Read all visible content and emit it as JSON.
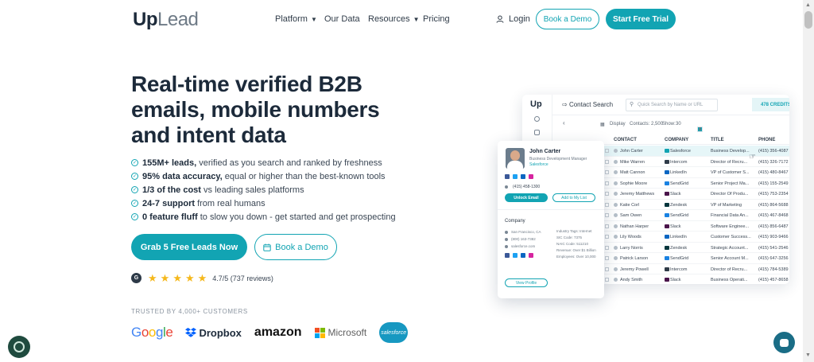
{
  "header": {
    "logo_up": "Up",
    "logo_lead": "Lead",
    "nav": [
      {
        "label": "Platform",
        "chevron": true
      },
      {
        "label": "Our Data",
        "chevron": false
      },
      {
        "label": "Resources",
        "chevron": true
      },
      {
        "label": "Pricing",
        "chevron": false
      }
    ],
    "login_label": "Login",
    "book_demo_label": "Book a Demo",
    "free_trial_label": "Start Free Trial"
  },
  "hero": {
    "title": "Real-time verified B2B emails, mobile numbers and intent data",
    "features": [
      {
        "bold": "155M+ leads,",
        "rest": " verified as you search and ranked by freshness"
      },
      {
        "bold": "95% data accuracy,",
        "rest": " equal or higher than the best-known tools"
      },
      {
        "bold": "1/3 of the cost",
        "rest": " vs leading sales platforms"
      },
      {
        "bold": "24-7 support",
        "rest": " from real humans"
      },
      {
        "bold": "0 feature fluff",
        "rest": " to slow you down - get started and get prospecting"
      }
    ],
    "cta_primary": "Grab 5 Free Leads Now",
    "cta_secondary": "Book a Demo",
    "rating_text": "4.7/5 (737 reviews)",
    "rating_stars": 5,
    "g2_badge": "G",
    "trusted_label": "TRUSTED BY 4,000+ CUSTOMERS",
    "customer_logos": {
      "google": "Google",
      "dropbox": "Dropbox",
      "amazon": "amazon",
      "microsoft": "Microsoft",
      "salesforce": "salesforce"
    }
  },
  "app_preview": {
    "logo": "Up",
    "title": "Contact Search",
    "search_placeholder": "Quick Search by Name or URL",
    "credits": "478 CREDITS",
    "toolbar": {
      "display": "Display",
      "contacts": "Contacts: 2,500",
      "show": "Show:",
      "show_value": "30",
      "pages": [
        "1",
        "2",
        "3",
        "4"
      ]
    },
    "columns": [
      "CONTACT",
      "COMPANY",
      "TITLE",
      "PHONE"
    ],
    "rows": [
      {
        "contact": "John Carter",
        "company": "Salesforce",
        "title": "Business Develop...",
        "phone": "(415) 356-4087"
      },
      {
        "contact": "Mike Warren",
        "company": "Intercom",
        "title": "Director of Recru...",
        "phone": "(415) 326-7172"
      },
      {
        "contact": "Matt Cannon",
        "company": "LinkedIn",
        "title": "VP of Customer S...",
        "phone": "(415) 480-8467"
      },
      {
        "contact": "Sophie Moore",
        "company": "SendGrid",
        "title": "Senior Project Ma...",
        "phone": "(415) 155-2549"
      },
      {
        "contact": "Jeremy Matthews",
        "company": "Slack",
        "title": "Director Of Produ...",
        "phone": "(415) 753-2354"
      },
      {
        "contact": "Katie Corl",
        "company": "Zendesk",
        "title": "VP of Marketing",
        "phone": "(415) 864-5688"
      },
      {
        "contact": "Sam Owen",
        "company": "SendGrid",
        "title": "Financial Data An...",
        "phone": "(415) 467-8468"
      },
      {
        "contact": "Nathan Harper",
        "company": "Slack",
        "title": "Software Enginee...",
        "phone": "(415) 856-6487"
      },
      {
        "contact": "Lily Woods",
        "company": "LinkedIn",
        "title": "Customer Success...",
        "phone": "(415) 903-9466"
      },
      {
        "contact": "Larry Norris",
        "company": "Zendesk",
        "title": "Strategic Account...",
        "phone": "(415) 541-2546"
      },
      {
        "contact": "Patrick Larson",
        "company": "SendGrid",
        "title": "Senior Account M...",
        "phone": "(415) 647-3256"
      },
      {
        "contact": "Jeremy Powell",
        "company": "Intercom",
        "title": "Director of Recru...",
        "phone": "(415) 784-5389"
      },
      {
        "contact": "Andy Smith",
        "company": "Slack",
        "title": "Business Operati...",
        "phone": "(415) 457-8658"
      }
    ]
  },
  "contact_card": {
    "name": "John Carter",
    "role": "Business Development Manager",
    "company": "Salesforce",
    "phone": "(415) 458-1300",
    "unlock_label": "Unlock Email",
    "add_list_label": "Add to My List",
    "company_section": "Company",
    "left_details": [
      "San Francisco, CA",
      "(800) 163-7382",
      "salesforce.com"
    ],
    "right_details": [
      "Industry Tags: Internet",
      "SIC Code: 7375",
      "NAIC Code: 511210",
      "Revenue: Over $1 Billion",
      "Employees: Over 10,000"
    ],
    "view_profile_label": "View Profile"
  },
  "colors": {
    "accent": "#12a4b3",
    "text_dark": "#1c2a3a",
    "star": "#f5b81b"
  }
}
